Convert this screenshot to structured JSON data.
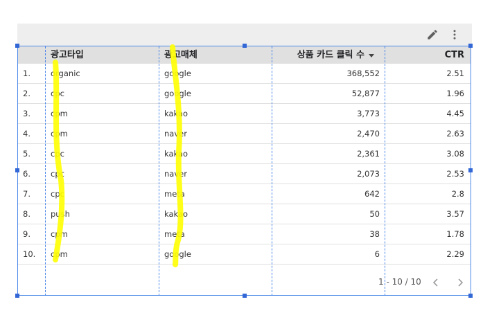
{
  "toolbar": {
    "edit_icon": "pencil-icon",
    "more_icon": "more-vert-icon"
  },
  "table": {
    "columns": [
      {
        "label": "광고타입",
        "align": "left"
      },
      {
        "label": "광고매체",
        "align": "left"
      },
      {
        "label": "상품 카드 클릭 수",
        "align": "right",
        "sorted": "desc"
      },
      {
        "label": "CTR",
        "align": "right"
      }
    ],
    "rows": [
      {
        "index": "1.",
        "type": "organic",
        "media": "google",
        "clicks": "368,552",
        "ctr": "2.51"
      },
      {
        "index": "2.",
        "type": "cpc",
        "media": "google",
        "clicks": "52,877",
        "ctr": "1.96"
      },
      {
        "index": "3.",
        "type": "cpm",
        "media": "kakao",
        "clicks": "3,773",
        "ctr": "4.45"
      },
      {
        "index": "4.",
        "type": "cpm",
        "media": "naver",
        "clicks": "2,470",
        "ctr": "2.63"
      },
      {
        "index": "5.",
        "type": "cpc",
        "media": "kakao",
        "clicks": "2,361",
        "ctr": "3.08"
      },
      {
        "index": "6.",
        "type": "cpc",
        "media": "naver",
        "clicks": "2,073",
        "ctr": "2.53"
      },
      {
        "index": "7.",
        "type": "cpc",
        "media": "meta",
        "clicks": "642",
        "ctr": "2.8"
      },
      {
        "index": "8.",
        "type": "push",
        "media": "kakao",
        "clicks": "50",
        "ctr": "3.57"
      },
      {
        "index": "9.",
        "type": "cpm",
        "media": "meta",
        "clicks": "38",
        "ctr": "1.78"
      },
      {
        "index": "10.",
        "type": "cpm",
        "media": "google",
        "clicks": "6",
        "ctr": "2.29"
      }
    ]
  },
  "pagination": {
    "range_text": "1 - 10 / 10",
    "prev_icon": "chevron-left-icon",
    "next_icon": "chevron-right-icon"
  },
  "colors": {
    "header_bg": "#e0e0e0",
    "toolbar_bg": "#eeeeee",
    "selection": "#4a86e8",
    "highlight": "#ffff00"
  }
}
